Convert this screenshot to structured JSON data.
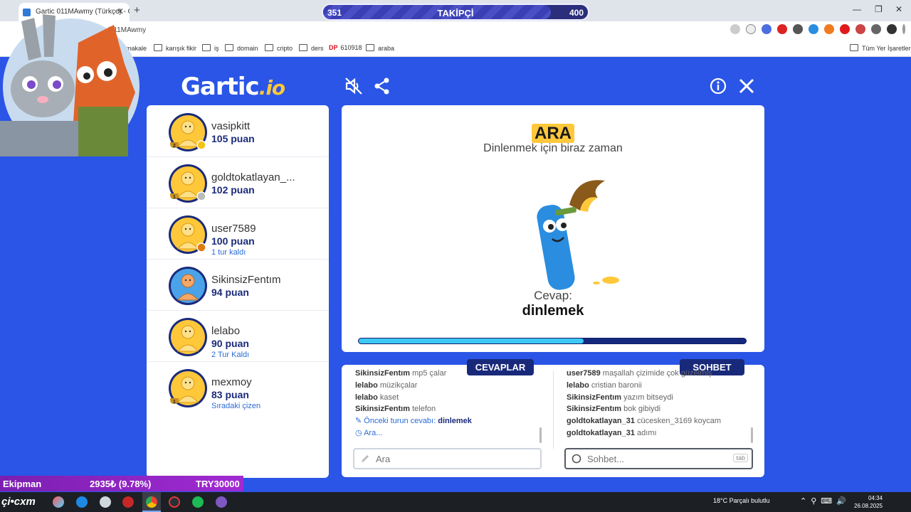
{
  "browser": {
    "tab_title": "Gartic 011MAwmy (Türkçe) - Gar",
    "url": "gartic.io/011MAwmy",
    "bookmarks": [
      "makale",
      "karışık fikir",
      "iş",
      "domain",
      "cripto",
      "ders",
      "610918",
      "araba"
    ],
    "all_bookmarks": "Tüm Yer İşaretleri"
  },
  "overlay": {
    "followers_current": "351",
    "followers_label": "TAKİPÇİ",
    "followers_goal": "400",
    "followers_fraction": 0.86,
    "ticker_name": "Ekipman",
    "ticker_change": "2935₺ (9.78%)",
    "ticker_value": "TRY30000"
  },
  "game": {
    "logo_main": "Gartic",
    "logo_suffix": ".io",
    "players": [
      {
        "name": "vasipkitt",
        "points": "105 puan",
        "note": "",
        "rank": "2",
        "badge": "#f5c21a"
      },
      {
        "name": "goldtokatlayan_...",
        "points": "102 puan",
        "note": "",
        "rank": "1",
        "badge": "#bbbbbb"
      },
      {
        "name": "user7589",
        "points": "100 puan",
        "note": "1 tur kaldı",
        "rank": "",
        "badge": "#e07a10"
      },
      {
        "name": "SikinsizFentım",
        "points": "94 puan",
        "note": "",
        "rank": "",
        "badge": ""
      },
      {
        "name": "lelabo",
        "points": "90 puan",
        "note": "2 Tur Kaldı",
        "rank": "",
        "badge": ""
      },
      {
        "name": "mexmoy",
        "points": "83 puan",
        "note": "Sıradaki çizen",
        "rank": "1",
        "badge": ""
      }
    ],
    "stage": {
      "title": "ARA",
      "subtitle": "Dinlenmek için biraz zaman",
      "answer_label": "Cevap:",
      "answer": "dinlemek",
      "progress": 0.58
    },
    "answers_tab": "CEVAPLAR",
    "chat_tab": "SOHBET",
    "answers": [
      {
        "user": "SikinsizFentım",
        "text": "mp5 çalar"
      },
      {
        "user": "lelabo",
        "text": "müzikçalar"
      },
      {
        "user": "lelabo",
        "text": "kaset"
      },
      {
        "user": "SikinsizFentım",
        "text": "telefon"
      }
    ],
    "prev_answer_label": "Önceki turun cevabı:",
    "prev_answer": "dinlemek",
    "ara_status": "Ara...",
    "chat": [
      {
        "user": "user7589",
        "text": "maşallah çizimide çok güzelmiş"
      },
      {
        "user": "lelabo",
        "text": "cristian baronii"
      },
      {
        "user": "SikinsizFentım",
        "text": "yazım bitseydi"
      },
      {
        "user": "SikinsizFentım",
        "text": "bok gibiydi"
      },
      {
        "user": "goldtokatlayan_31",
        "text": "cücesken_3169 koycam"
      },
      {
        "user": "goldtokatlayan_31",
        "text": "adımı"
      }
    ],
    "answer_placeholder": "Ara",
    "chat_placeholder": "Sohbet...",
    "tab_key": "tab"
  },
  "taskbar": {
    "start_text": "çi•cxm",
    "weather": "18°C  Parçalı bulutlu",
    "time": "04:34",
    "date": "26.08.2025"
  }
}
